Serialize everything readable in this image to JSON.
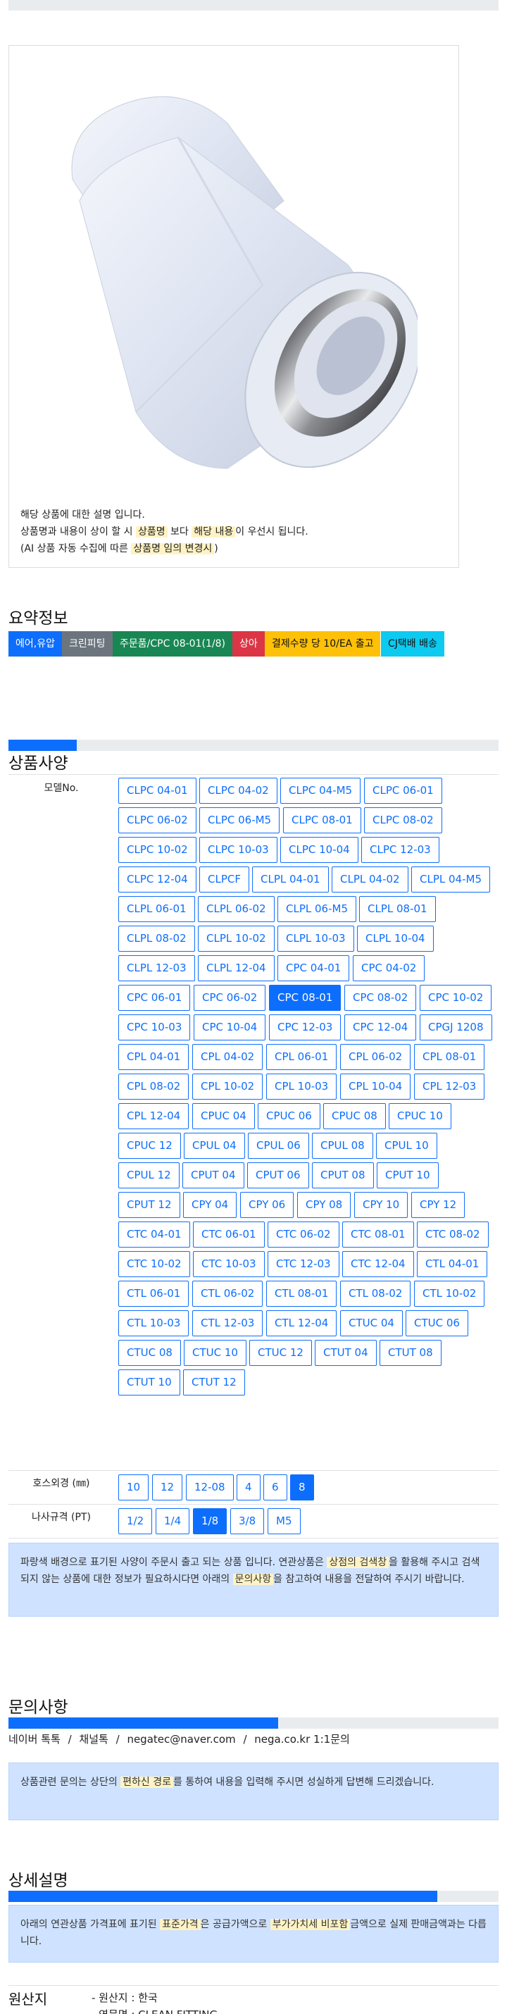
{
  "image_description": {
    "line1": "해당 상품에 대한 설명 입니다.",
    "line2_prefix": "상품명과 내용이 상이 할 시",
    "line2_hl1": "상품명",
    "line2_mid": "보다",
    "line2_hl2": "해당 내용",
    "line2_suffix": "이 우선시 됩니다.",
    "line3_prefix": "(AI 상품 자동 수집에 따른",
    "line3_hl": "상품명 임의 변경시",
    "line3_suffix": ")"
  },
  "summary": {
    "title": "요약정보",
    "badges": [
      {
        "label": "에어,유압",
        "color": "#0d6efd"
      },
      {
        "label": "크린피팅",
        "color": "#6c757d"
      },
      {
        "label": "주문품/CPC 08-01(1/8)",
        "color": "#198754"
      },
      {
        "label": "상아",
        "color": "#dc3545"
      },
      {
        "label": "결제수량 당 10/EA 출고",
        "color": "#ffc107",
        "text_color": "#111111"
      },
      {
        "label": "CJ택배 배송",
        "color": "#0dcaf0",
        "text_color": "#111111"
      }
    ]
  },
  "spec": {
    "title": "상품사양",
    "progress_fraction": 0.14,
    "model_label": "모델No.",
    "models": [
      "CLPC 04-01",
      "CLPC 04-02",
      "CLPC 04-M5",
      "CLPC 06-01",
      "CLPC 06-02",
      "CLPC 06-M5",
      "CLPC 08-01",
      "CLPC 08-02",
      "CLPC 10-02",
      "CLPC 10-03",
      "CLPC 10-04",
      "CLPC 12-03",
      "CLPC 12-04",
      "CLPCF",
      "CLPL 04-01",
      "CLPL 04-02",
      "CLPL 04-M5",
      "CLPL 06-01",
      "CLPL 06-02",
      "CLPL 06-M5",
      "CLPL 08-01",
      "CLPL 08-02",
      "CLPL 10-02",
      "CLPL 10-03",
      "CLPL 10-04",
      "CLPL 12-03",
      "CLPL 12-04",
      "CPC 04-01",
      "CPC 04-02",
      "CPC 06-01",
      "CPC 06-02",
      "CPC 08-01",
      "CPC 08-02",
      "CPC 10-02",
      "CPC 10-03",
      "CPC 10-04",
      "CPC 12-03",
      "CPC 12-04",
      "CPGJ 1208",
      "CPL 04-01",
      "CPL 04-02",
      "CPL 06-01",
      "CPL 06-02",
      "CPL 08-01",
      "CPL 08-02",
      "CPL 10-02",
      "CPL 10-03",
      "CPL 10-04",
      "CPL 12-03",
      "CPL 12-04",
      "CPUC 04",
      "CPUC 06",
      "CPUC 08",
      "CPUC 10",
      "CPUC 12",
      "CPUL 04",
      "CPUL 06",
      "CPUL 08",
      "CPUL 10",
      "CPUL 12",
      "CPUT 04",
      "CPUT 06",
      "CPUT 08",
      "CPUT 10",
      "CPUT 12",
      "CPY 04",
      "CPY 06",
      "CPY 08",
      "CPY 10",
      "CPY 12",
      "CTC 04-01",
      "CTC 06-01",
      "CTC 06-02",
      "CTC 08-01",
      "CTC 08-02",
      "CTC 10-02",
      "CTC 10-03",
      "CTC 12-03",
      "CTC 12-04",
      "CTL 04-01",
      "CTL 06-01",
      "CTL 06-02",
      "CTL 08-01",
      "CTL 08-02",
      "CTL 10-02",
      "CTL 10-03",
      "CTL 12-03",
      "CTL 12-04",
      "CTUC 04",
      "CTUC 06",
      "CTUC 08",
      "CTUC 10",
      "CTUC 12",
      "CTUT 04",
      "CTUT 08",
      "CTUT 10",
      "CTUT 12"
    ],
    "selected_model": "CPC 08-01",
    "hose_label": "호스외경 (㎜)",
    "hose_options": [
      "10",
      "12",
      "12-08",
      "4",
      "6",
      "8"
    ],
    "selected_hose": "8",
    "thread_label": "나사규격 (PT)",
    "thread_options": [
      "1/2",
      "1/4",
      "1/8",
      "3/8",
      "M5"
    ],
    "selected_thread": "1/8",
    "notice": {
      "p1": "파랑색 배경으로 표기된 사양이 주문시 출고 되는 상품 입니다. 연관상품은",
      "hl1": "상점의 검색창",
      "p2": "을 활용해 주시고 검색되지 않는 상품에 대한 정보가 필요하시다면 아래의",
      "hl2": "문의사항",
      "p3": "을 참고하여 내용을 전달하여 주시기 바랍니다."
    }
  },
  "inquiry": {
    "title": "문의사항",
    "progress_fraction": 0.55,
    "contacts": [
      "네이버 톡톡",
      "채널톡",
      "negatec@naver.com",
      "nega.co.kr 1:1문의"
    ],
    "separator": "/",
    "notice": {
      "p1": "상품관련 문의는 상단의",
      "hl": "편하신 경로",
      "p2": "를 통하여 내용을 입력해 주시면 성실하게 답변해 드리겠습니다."
    }
  },
  "detail": {
    "title": "상세설명",
    "progress_fraction": 0.875,
    "notice": {
      "p1": "아래의 연관상품 가격표에 표기된",
      "hl1": "표준가격",
      "p2": "은 공급가액으로",
      "hl2": "부가가치세 비포함",
      "p3": "금액으로 실제 판매금액과는 다릅니다."
    }
  },
  "origin": {
    "title": "원산지",
    "items": [
      "- 원산지 : 한국",
      "- 영문명 : CLEAN FITTING"
    ]
  }
}
